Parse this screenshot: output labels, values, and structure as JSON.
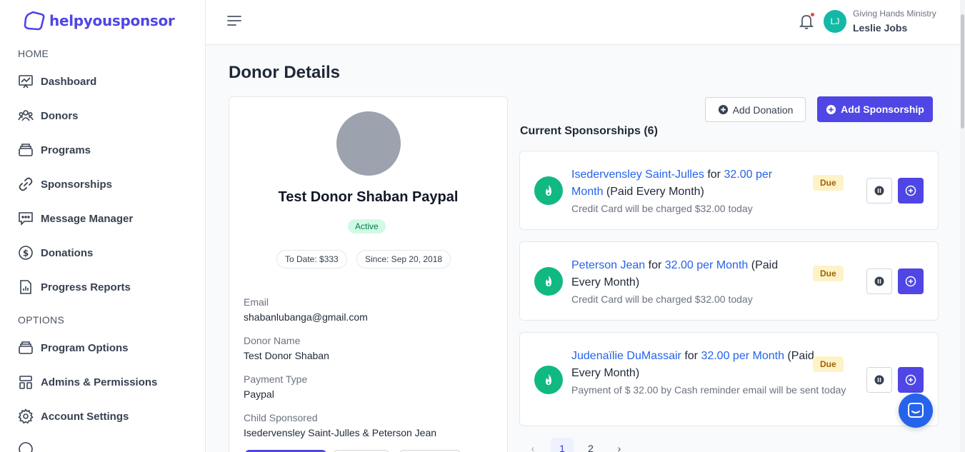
{
  "brand": {
    "name": "helpyousponsor",
    "color": "#4f46e5"
  },
  "sidebar": {
    "home_label": "HOME",
    "options_label": "OPTIONS",
    "home_items": [
      {
        "label": "Dashboard",
        "icon": "chart-icon"
      },
      {
        "label": "Donors",
        "icon": "users-icon"
      },
      {
        "label": "Programs",
        "icon": "stack-icon"
      },
      {
        "label": "Sponsorships",
        "icon": "link-icon"
      },
      {
        "label": "Message Manager",
        "icon": "message-icon"
      },
      {
        "label": "Donations",
        "icon": "dollar-icon"
      },
      {
        "label": "Progress Reports",
        "icon": "report-icon"
      }
    ],
    "option_items": [
      {
        "label": "Program Options",
        "icon": "stack-icon"
      },
      {
        "label": "Admins & Permissions",
        "icon": "grid-icon"
      },
      {
        "label": "Account Settings",
        "icon": "gear-icon"
      }
    ]
  },
  "header": {
    "org": "Giving Hands Ministry",
    "user": "Leslie Jobs",
    "initials": "LJ"
  },
  "page": {
    "title": "Donor Details"
  },
  "donor": {
    "name": "Test Donor Shaban Paypal",
    "status": "Active",
    "to_date": "To Date: $333",
    "since": "Since: Sep 20, 2018",
    "fields": [
      {
        "label": "Email",
        "value": "shabanlubanga@gmail.com"
      },
      {
        "label": "Donor Name",
        "value": "Test Donor Shaban"
      },
      {
        "label": "Payment Type",
        "value": "Paypal"
      },
      {
        "label": "Child Sponsored",
        "value": "Isedervensley Saint-Julles & Peterson Jean"
      }
    ]
  },
  "actions": {
    "add_donation": "Add Donation",
    "add_sponsorship": "Add Sponsorship"
  },
  "sponsorships": {
    "heading": "Current Sponsorships (6)",
    "items": [
      {
        "name": "Isedervensley Saint-Julles",
        "for": "for",
        "amount": "32.00 per Month",
        "freq": "(Paid Every Month)",
        "note": "Credit Card will be charged $32.00 today",
        "badge": "Due"
      },
      {
        "name": "Peterson Jean",
        "for": "for",
        "amount": "32.00 per Month",
        "freq": "(Paid Every Month)",
        "note": "Credit Card will be charged $32.00 today",
        "badge": "Due"
      },
      {
        "name": "Judenaïlie DuMassair",
        "for": "for",
        "amount": "32.00 per Month",
        "freq": "(Paid Every Month)",
        "note": "Payment of $ 32.00 by Cash reminder email will be sent today",
        "badge": "Due"
      }
    ]
  },
  "pagination": {
    "prev": "‹",
    "pages": [
      "1",
      "2"
    ],
    "next": "›",
    "current": "1"
  }
}
